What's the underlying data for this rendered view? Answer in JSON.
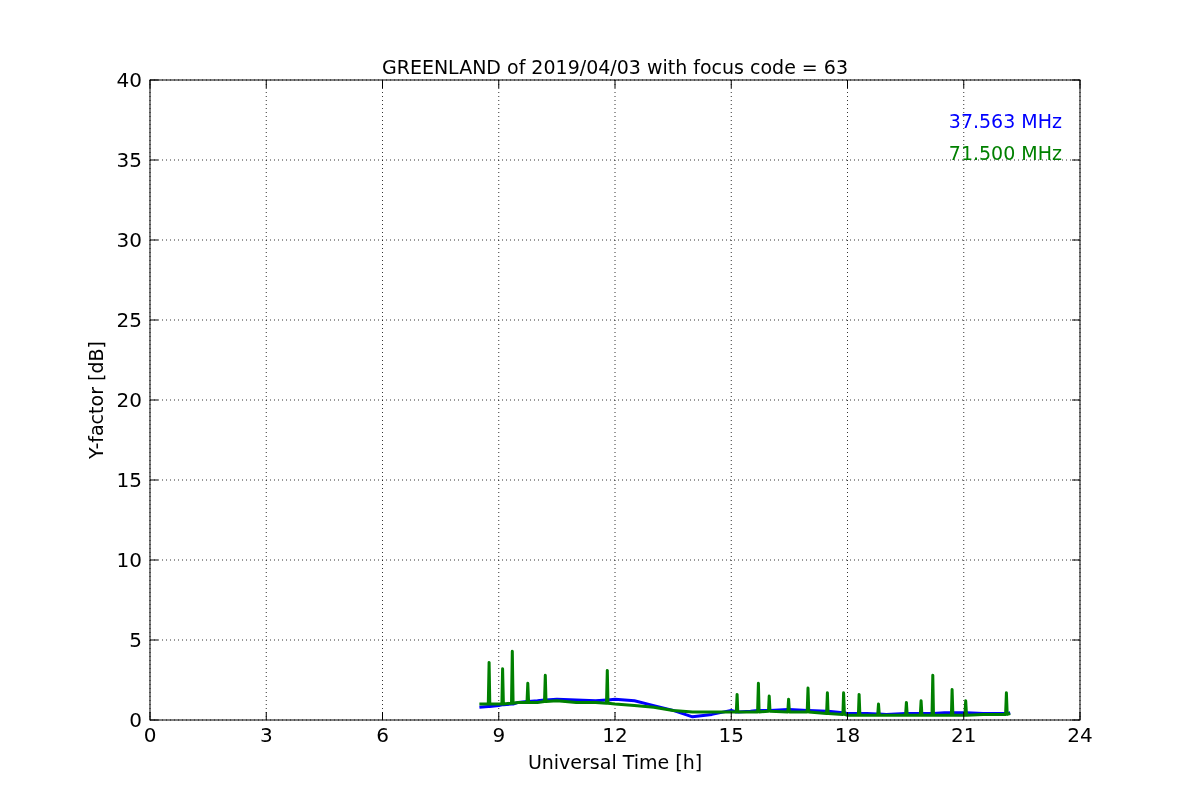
{
  "chart_data": {
    "type": "line",
    "grid": true,
    "title": "GREENLAND of 2019/04/03 with focus code = 63",
    "xlabel": "Universal Time [h]",
    "ylabel": "Y-factor [dB]",
    "xlim": [
      0,
      24
    ],
    "ylim": [
      0,
      40
    ],
    "xticks": [
      0,
      3,
      6,
      9,
      12,
      15,
      18,
      21,
      24
    ],
    "yticks": [
      0,
      5,
      10,
      15,
      20,
      25,
      30,
      35,
      40
    ],
    "x": [
      8.5,
      8.73,
      8.75,
      8.77,
      9,
      9.08,
      9.1,
      9.12,
      9.33,
      9.35,
      9.37,
      9.5,
      9.73,
      9.75,
      9.77,
      10,
      10.18,
      10.2,
      10.22,
      10.5,
      11,
      11.5,
      11.78,
      11.8,
      11.82,
      12,
      12.5,
      13,
      13.5,
      14,
      14.5,
      15,
      15.13,
      15.15,
      15.17,
      15.5,
      15.68,
      15.7,
      15.72,
      15.96,
      15.98,
      16,
      16.46,
      16.48,
      16.5,
      16.96,
      16.98,
      17,
      17.46,
      17.48,
      17.5,
      17.88,
      17.9,
      17.92,
      18,
      18.28,
      18.3,
      18.32,
      18.5,
      18.78,
      18.8,
      18.82,
      19,
      19.5,
      19.52,
      19.54,
      19.88,
      19.9,
      19.92,
      20.18,
      20.2,
      20.22,
      20.5,
      20.68,
      20.7,
      20.72,
      21,
      21.03,
      21.05,
      21.07,
      21.5,
      22,
      22.08,
      22.1,
      22.12,
      22.2
    ],
    "series": [
      {
        "name": "37.563 MHz",
        "color": "#0000ff",
        "values": [
          0.8,
          0.85,
          0.85,
          0.85,
          0.9,
          0.95,
          0.95,
          0.95,
          1.0,
          1.0,
          1.0,
          1.1,
          1.15,
          1.15,
          1.15,
          1.2,
          1.25,
          1.25,
          1.25,
          1.3,
          1.25,
          1.2,
          1.25,
          1.25,
          1.25,
          1.3,
          1.2,
          0.9,
          0.6,
          0.2,
          0.35,
          0.6,
          0.5,
          0.5,
          0.5,
          0.55,
          0.6,
          0.6,
          0.6,
          0.6,
          0.6,
          0.6,
          0.65,
          0.65,
          0.65,
          0.6,
          0.6,
          0.6,
          0.55,
          0.55,
          0.55,
          0.45,
          0.45,
          0.45,
          0.4,
          0.4,
          0.4,
          0.4,
          0.4,
          0.38,
          0.38,
          0.38,
          0.35,
          0.4,
          0.4,
          0.4,
          0.4,
          0.4,
          0.4,
          0.4,
          0.4,
          0.4,
          0.45,
          0.45,
          0.45,
          0.45,
          0.45,
          0.45,
          0.45,
          0.45,
          0.4,
          0.4,
          0.4,
          0.4,
          0.4,
          0.45
        ]
      },
      {
        "name": "71.500 MHz",
        "color": "#008000",
        "values": [
          1.0,
          1.0,
          3.6,
          1.0,
          1.0,
          1.0,
          3.2,
          1.0,
          1.05,
          4.3,
          1.05,
          1.1,
          1.1,
          2.3,
          1.1,
          1.1,
          1.15,
          2.8,
          1.15,
          1.2,
          1.1,
          1.1,
          1.05,
          3.1,
          1.05,
          1.0,
          0.9,
          0.8,
          0.6,
          0.5,
          0.5,
          0.5,
          0.5,
          1.6,
          0.5,
          0.5,
          0.5,
          2.3,
          0.5,
          0.55,
          1.5,
          0.55,
          0.5,
          1.3,
          0.5,
          0.5,
          2.0,
          0.5,
          0.4,
          1.7,
          0.4,
          0.35,
          1.7,
          0.35,
          0.3,
          0.3,
          1.6,
          0.3,
          0.3,
          0.3,
          1.0,
          0.3,
          0.3,
          0.3,
          1.1,
          0.3,
          0.3,
          1.2,
          0.3,
          0.3,
          2.8,
          0.3,
          0.3,
          0.3,
          1.9,
          0.3,
          0.3,
          0.3,
          1.2,
          0.3,
          0.35,
          0.35,
          0.35,
          1.7,
          0.35,
          0.4
        ]
      }
    ]
  }
}
